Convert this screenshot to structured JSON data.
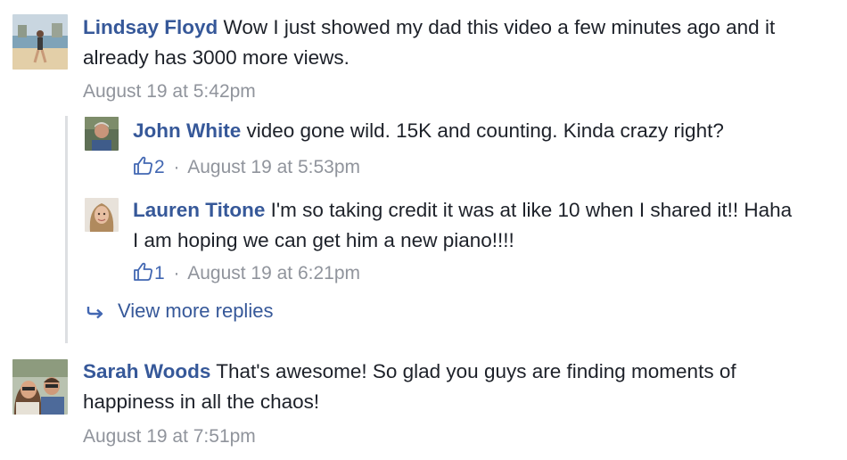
{
  "comments": [
    {
      "author": "Lindsay Floyd",
      "text": "Wow I just showed my dad this video a few minutes ago and it already has 3000 more views.",
      "time": "August 19 at 5:42pm"
    },
    {
      "author": "Sarah Woods",
      "text": "That's awesome! So glad you guys are finding moments of happiness in all the chaos!",
      "time": "August 19 at 7:51pm"
    }
  ],
  "replies": [
    {
      "author": "John White",
      "text": "video gone wild. 15K and counting. Kinda crazy right?",
      "likes": "2",
      "time": "August 19 at 5:53pm"
    },
    {
      "author": "Lauren Titone",
      "text": "I'm so taking credit it was at like 10 when I shared it!! Haha I am hoping we can get him a new piano!!!!",
      "likes": "1",
      "time": "August 19 at 6:21pm"
    }
  ],
  "view_more_label": "View more replies",
  "separator": "·",
  "icons": {
    "like": "thumbs-up-icon",
    "reply_arrow": "reply-arrow-icon"
  },
  "colors": {
    "author": "#365899",
    "meta": "#90949c",
    "like": "#4267b2",
    "thread_line": "#dddfe2"
  }
}
